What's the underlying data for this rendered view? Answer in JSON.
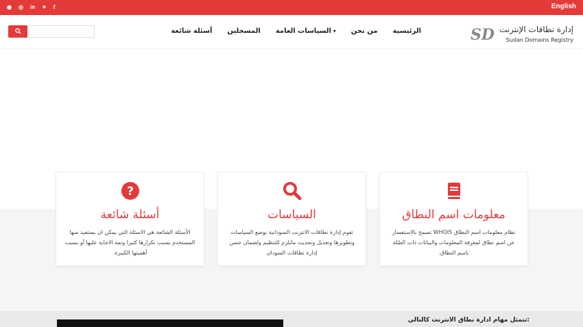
{
  "topbar": {
    "lang": "English",
    "social": [
      "rss",
      "instagram",
      "linkedin",
      "twitter",
      "facebook"
    ]
  },
  "logo": {
    "ar": "إدارة نطاقات الإنترنت",
    "en": "Sudan Domains Registry",
    "mark": "SD"
  },
  "menu": [
    "الرئيسية",
    "من نحن",
    "السياسات العامة",
    "المسجلين",
    "أسئلة شائعة"
  ],
  "search": {
    "placeholder": ""
  },
  "cards": [
    {
      "title": "معلومات اسم النطاق",
      "icon": "book-icon",
      "text": "نظام معلومات اسم النطاق WHOIS تسمح بالاستفسار عن اسم نطاق لمعرفة المعلومات والبيانات ذات الصّلة باسم النطاق."
    },
    {
      "title": "السياسات",
      "icon": "search-icon",
      "text": "تقوم إدارة نطاقات الانترنت السودانية بوضع السياسات وتطويرها وتعديل وتحديث مايلزم للتنظيم ولضمان حسن إدارة نطاقات السودان"
    },
    {
      "title": "أسئلة شائعة",
      "icon": "question-icon",
      "text": "الأسئلة الشائعة هي الاسئلة التي يمكن ان يستفيد منها المستخدم بسبب تكرارها كثيرا وتمة الاجابة عليها أو بسبب أهميتها الكبيرة."
    }
  ],
  "footer": {
    "title": "تتمثل مهام ادارة نطاق الانترنت كالتالي:"
  },
  "colors": {
    "accent": "#e53a3a"
  }
}
